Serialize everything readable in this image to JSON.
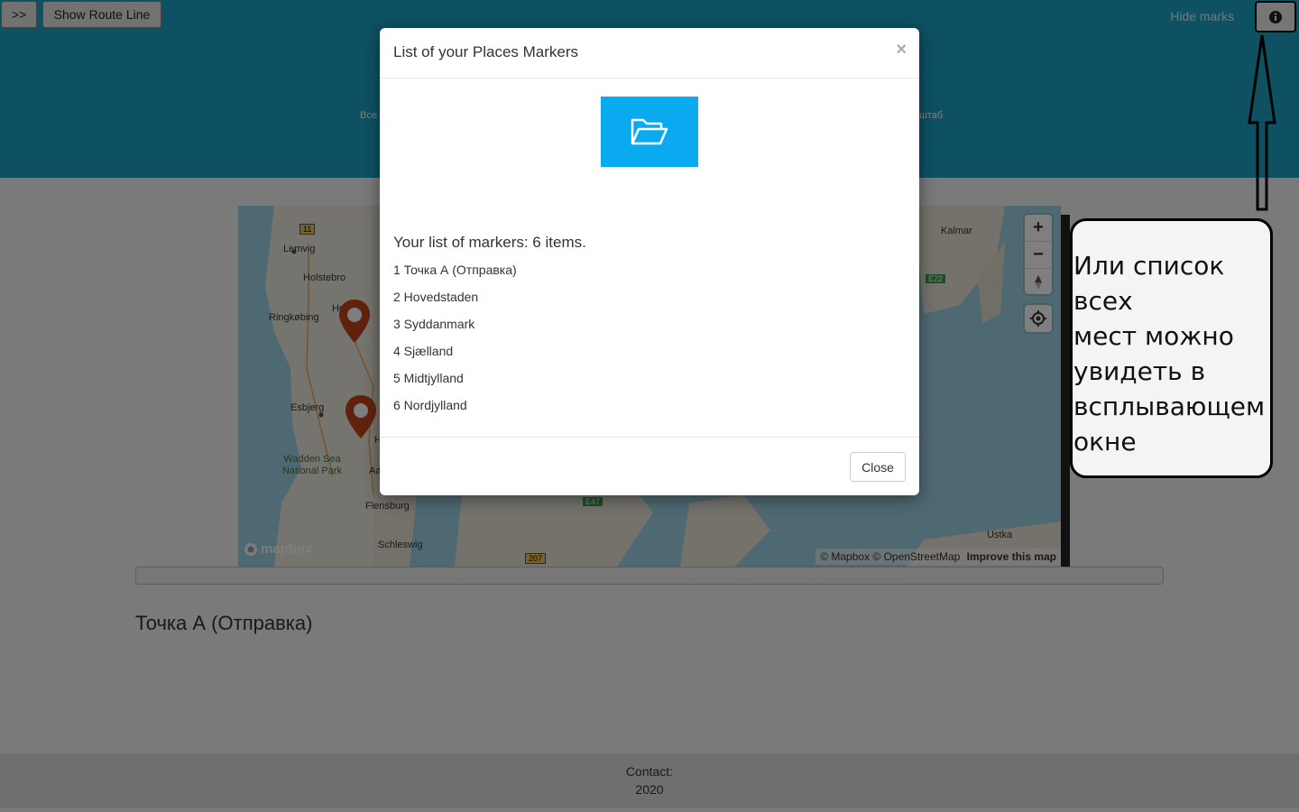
{
  "toolbar": {
    "toggle_label": ">>",
    "route_label": "Show Route Line",
    "hide_marks": "Hide marks",
    "info_icon": "info-icon"
  },
  "header": {
    "fragment_left": "Все",
    "fragment_right": "штаб"
  },
  "map": {
    "places": [
      "Lemvig",
      "Holstebro",
      "Herning",
      "Ringkøbing",
      "Esbjerg",
      "Wadden Sea National Park",
      "Flensburg",
      "Schleswig",
      "Kalmar",
      "Ustka"
    ],
    "road_labels": [
      "11",
      "E22",
      "E47",
      "207"
    ],
    "partial_labels": [
      "Aa",
      "H"
    ],
    "attribution": "© Mapbox © OpenStreetMap",
    "improve": "Improve this map",
    "logo": "mapbox",
    "zoom_in": "+",
    "zoom_out": "−"
  },
  "main": {
    "current_place": "Точка А (Отправка)"
  },
  "footer": {
    "contact": "Contact:",
    "year": "2020"
  },
  "modal": {
    "title": "List of your Places Markers",
    "close_x": "×",
    "list_heading": "Your list of markers: 6 items.",
    "items": [
      "1 Точка А (Отправка)",
      "2 Hovedstaden",
      "3 Syddanmark",
      "4 Sjælland",
      "5 Midtjylland",
      "6 Nordjylland"
    ],
    "close_button": "Close"
  },
  "annotation": {
    "text": "Или список всех\nмест можно\nувидеть в\nвсплывающем\nокне"
  },
  "colors": {
    "header": "#1ba3c6",
    "folder_tile": "#0aaaf0",
    "marker": "#c0441b"
  }
}
